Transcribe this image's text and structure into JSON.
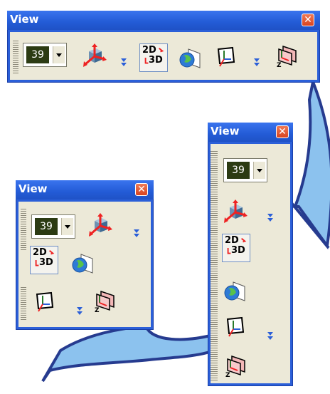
{
  "windows": {
    "horizontal": {
      "title": "View",
      "close_label": "✕",
      "zoom_value": "39"
    },
    "vertical": {
      "title": "View",
      "close_label": "✕",
      "zoom_value": "39"
    },
    "compact": {
      "title": "View",
      "close_label": "✕",
      "zoom_value": "39"
    }
  },
  "labels": {
    "view_2d": "2D",
    "view_3d": "3D"
  },
  "colors": {
    "title_bar": "#2b5fd8",
    "toolbar_bg": "#ece9d8",
    "zoom_box": "#2c3b13",
    "close_button": "#e0562f",
    "arrow_fill": "#8cc2ee",
    "arrow_outline": "#263b8f"
  },
  "icons": [
    "zoom-combo",
    "orientation-icon",
    "2d-3d-toggle-icon",
    "globe-view-icon",
    "axes-plane-icon",
    "layer-plane-icon",
    "dropdown-arrow-icon"
  ]
}
